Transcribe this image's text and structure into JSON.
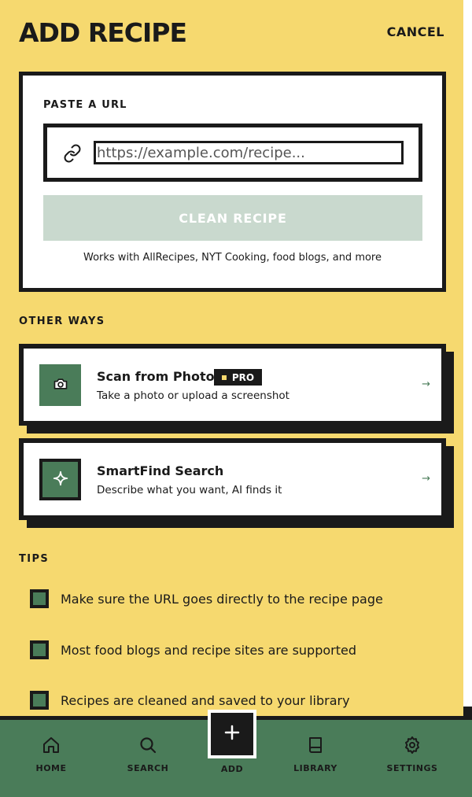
{
  "header": {
    "title": "ADD RECIPE",
    "cancel_label": "CANCEL"
  },
  "url_card": {
    "label": "PASTE A URL",
    "input_placeholder": "https://example.com/recipe...",
    "input_value": "",
    "clean_button_label": "CLEAN RECIPE",
    "note": "Works with AllRecipes, NYT Cooking, food blogs, and more"
  },
  "other_ways": {
    "label": "OTHER WAYS",
    "options": [
      {
        "title": "Scan from Photo",
        "badge": "PRO",
        "subtitle": "Take a photo or upload a screenshot",
        "arrow": "→",
        "icon": "camera-icon"
      },
      {
        "title": "SmartFind Search",
        "subtitle": "Describe what you want, AI finds it",
        "arrow": "→",
        "icon": "sparkle-icon"
      }
    ]
  },
  "tips": {
    "label": "TIPS",
    "items": [
      "Make sure the URL goes directly to the recipe page",
      "Most food blogs and recipe sites are supported",
      "Recipes are cleaned and saved to your library"
    ]
  },
  "nav": {
    "items": [
      {
        "label": "HOME",
        "icon": "home-icon"
      },
      {
        "label": "SEARCH",
        "icon": "search-icon"
      },
      {
        "label": "ADD",
        "icon": "plus-icon"
      },
      {
        "label": "LIBRARY",
        "icon": "book-icon"
      },
      {
        "label": "SETTINGS",
        "icon": "gear-icon"
      }
    ]
  },
  "colors": {
    "background": "#f6d96f",
    "accent_green": "#4a7c59",
    "ink": "#1a1a1a",
    "disabled_button": "#c9d9ce"
  }
}
